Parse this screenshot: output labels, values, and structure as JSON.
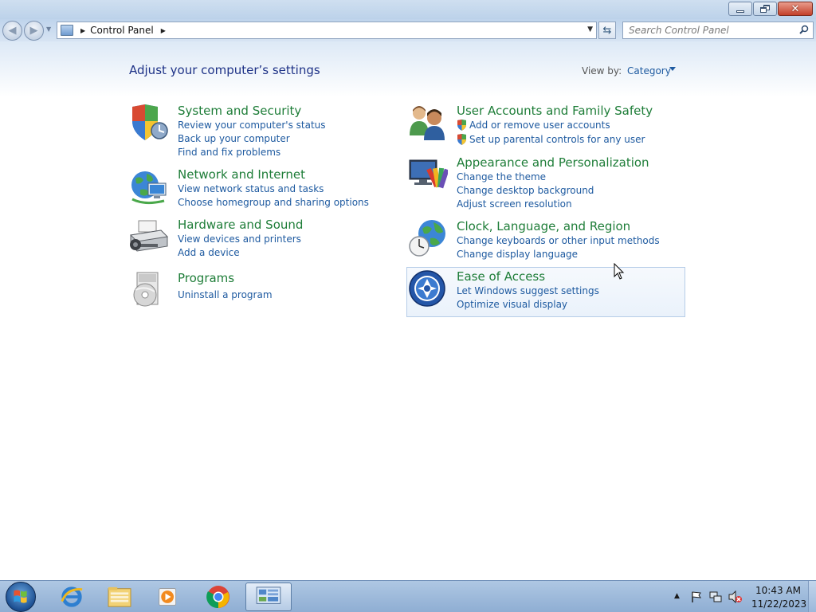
{
  "window": {
    "title": "Control Panel",
    "min_icon": "minimize-icon",
    "max_icon": "restore-icon",
    "close_icon": "close-icon"
  },
  "nav": {
    "back_icon": "back-arrow-icon",
    "forward_icon": "forward-arrow-icon",
    "breadcrumb": "Control Panel",
    "refresh_icon": "refresh-icon",
    "search_placeholder": "Search Control Panel"
  },
  "main": {
    "title": "Adjust your computer’s settings",
    "view_by_label": "View by:",
    "view_by_value": "Category",
    "categories": [
      {
        "title": "System and Security",
        "icon": "shield-security-icon",
        "links": [
          "Review your computer's status",
          "Back up your computer",
          "Find and fix problems"
        ]
      },
      {
        "title": "Network and Internet",
        "icon": "network-globe-icon",
        "links": [
          "View network status and tasks",
          "Choose homegroup and sharing options"
        ]
      },
      {
        "title": "Hardware and Sound",
        "icon": "printer-speaker-icon",
        "links": [
          "View devices and printers",
          "Add a device"
        ]
      },
      {
        "title": "Programs",
        "icon": "programs-disc-icon",
        "links": [
          "Uninstall a program"
        ]
      },
      {
        "title": "User Accounts and Family Safety",
        "icon": "users-icon",
        "links": [
          "Add or remove user accounts",
          "Set up parental controls for any user"
        ]
      },
      {
        "title": "Appearance and Personalization",
        "icon": "monitor-palette-icon",
        "links": [
          "Change the theme",
          "Change desktop background",
          "Adjust screen resolution"
        ]
      },
      {
        "title": "Clock, Language, and Region",
        "icon": "clock-globe-icon",
        "links": [
          "Change keyboards or other input methods",
          "Change display language"
        ]
      },
      {
        "title": "Ease of Access",
        "icon": "ease-of-access-icon",
        "links": [
          "Let Windows suggest settings",
          "Optimize visual display"
        ]
      }
    ]
  },
  "taskbar": {
    "items": [
      "Start",
      "Internet Explorer",
      "Windows Explorer",
      "Windows Media Player",
      "Google Chrome",
      "Control Panel"
    ],
    "time": "10:43 AM",
    "date": "11/22/2023"
  },
  "colors": {
    "category_title": "#1e7d38",
    "link": "#1e5aa0",
    "page_title": "#1e3287"
  }
}
